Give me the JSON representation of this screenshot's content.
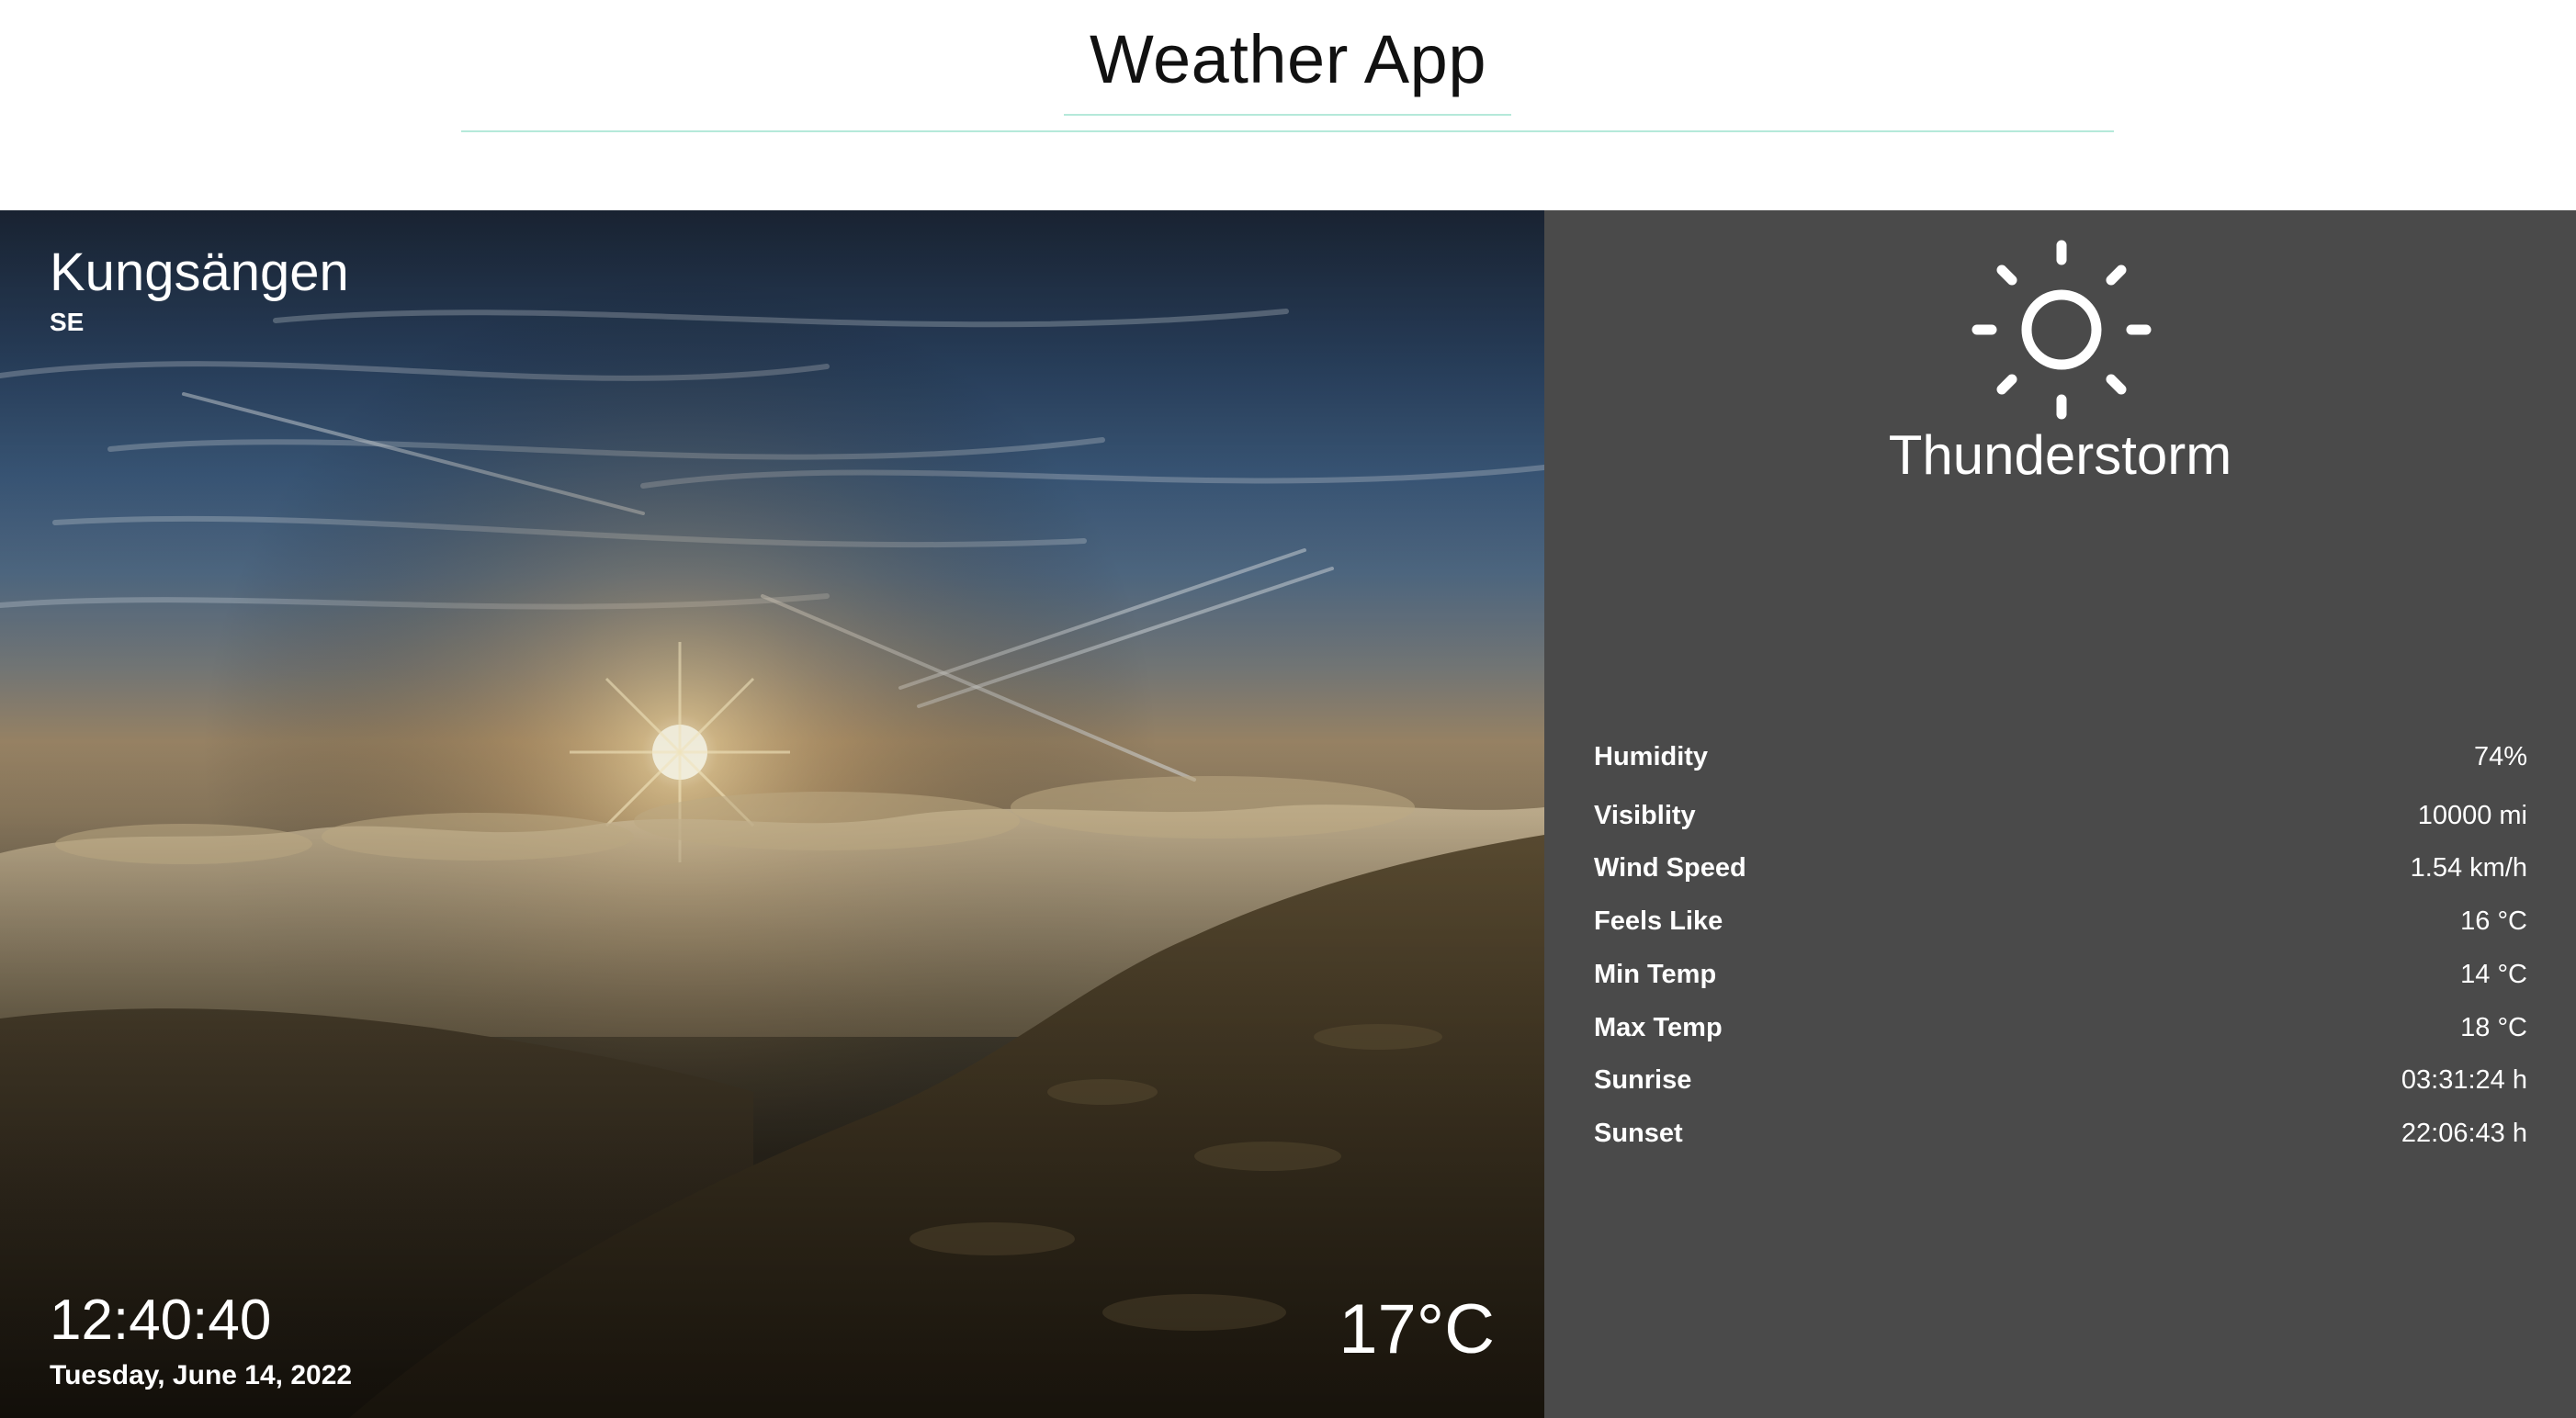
{
  "app": {
    "title": "Weather App"
  },
  "location": {
    "city": "Kungsängen",
    "country": "SE"
  },
  "time": {
    "clock": "12:40:40",
    "date": "Tuesday, June 14, 2022"
  },
  "current": {
    "temperature": "17°C",
    "condition": "Thunderstorm",
    "icon": "sun-icon"
  },
  "stats": [
    {
      "label": "Humidity",
      "value": "74%"
    },
    {
      "label": "Visiblity",
      "value": "10000 mi"
    },
    {
      "label": "Wind Speed",
      "value": "1.54 km/h"
    },
    {
      "label": "Feels Like",
      "value": "16 °C"
    },
    {
      "label": "Min Temp",
      "value": "14 °C"
    },
    {
      "label": "Max Temp",
      "value": "18 °C"
    },
    {
      "label": "Sunrise",
      "value": "03:31:24 h"
    },
    {
      "label": "Sunset",
      "value": "22:06:43 h"
    }
  ],
  "colors": {
    "accent_line": "#b5e9da",
    "panel_background": "#4a4a4a",
    "text_light": "#ffffff"
  }
}
